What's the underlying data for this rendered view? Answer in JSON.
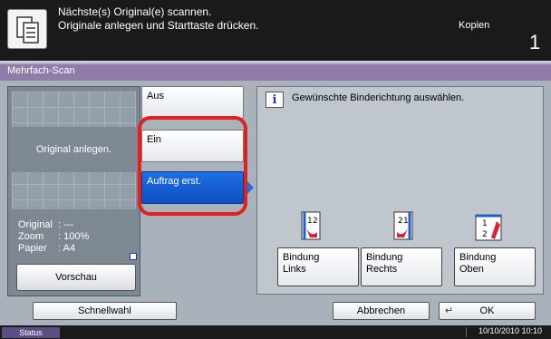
{
  "header": {
    "message_line1": "Nächste(s) Original(e) scannen.",
    "message_line2": "Originale anlegen und Starttaste drücken.",
    "mode": "Kopien",
    "copies": "1",
    "icon": "copy-scan-icon"
  },
  "title": "Mehrfach-Scan",
  "preview": {
    "message": "Original anlegen.",
    "info": {
      "original_label": "Original",
      "original_value": ": ---",
      "zoom_label": "Zoom",
      "zoom_value": ": 100%",
      "paper_label": "Papier",
      "paper_value": ": A4"
    },
    "button": "Vorschau"
  },
  "options": {
    "aus": "Aus",
    "ein": "Ein",
    "auftrag": "Auftrag erst.",
    "selected": "Auftrag erst."
  },
  "binding": {
    "instruction": "Gewünschte Binderichtung auswählen.",
    "info_icon": "i",
    "buttons": [
      {
        "line1": "Bindung",
        "line2": "Links",
        "icon": "binding-left-icon"
      },
      {
        "line1": "Bindung",
        "line2": "Rechts",
        "icon": "binding-right-icon"
      },
      {
        "line1": "Bindung",
        "line2": "Oben",
        "icon": "binding-top-icon"
      }
    ]
  },
  "bottom": {
    "quick": "Schnellwahl",
    "cancel": "Abbrechen",
    "ok": "OK"
  },
  "status": {
    "button": "Status",
    "datetime": "10/10/2010  10:10"
  },
  "colors": {
    "title_bar": "#8f7ca8",
    "selected_button": "#1f6fe0",
    "highlight": "#e0211f"
  }
}
